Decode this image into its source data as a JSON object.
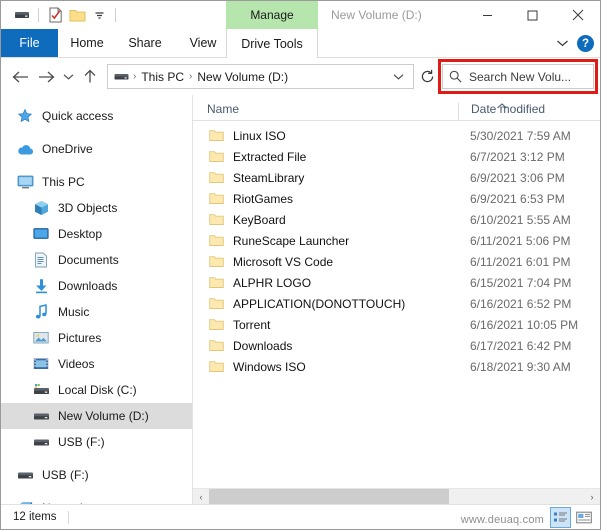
{
  "window": {
    "title": "New Volume (D:)",
    "contextual_header": "Manage",
    "minimize": "—",
    "maximize": "□",
    "close": "✕"
  },
  "quick_access_toolbar": {
    "items": [
      {
        "icon": "drive-icon",
        "name": "drive"
      },
      {
        "icon": "properties-icon",
        "name": "properties"
      },
      {
        "icon": "new-folder-icon",
        "name": "new-folder"
      },
      {
        "icon": "chevron-down-icon",
        "name": "customize"
      }
    ]
  },
  "ribbon": {
    "file_tab": "File",
    "tabs": [
      "Home",
      "Share",
      "View"
    ],
    "contextual_tab": "Drive Tools",
    "collapse_icon": "chevron-down-icon",
    "help_label": "?"
  },
  "address_bar": {
    "back_icon": "arrow-left-icon",
    "forward_icon": "arrow-right-icon",
    "recent_icon": "chevron-down-icon",
    "up_icon": "arrow-up-icon",
    "drive_icon": "drive-icon",
    "breadcrumbs": [
      "This PC",
      "New Volume (D:)"
    ],
    "separator": "›",
    "dropdown_icon": "chevron-down-icon",
    "refresh_icon": "refresh-icon"
  },
  "search": {
    "placeholder": "Search New Volu...",
    "icon": "search-icon",
    "highlight_color": "#e01b15"
  },
  "sidebar": {
    "items": [
      {
        "label": "Quick access",
        "icon": "star-icon",
        "indent": false,
        "selected": false,
        "gap_after": true
      },
      {
        "label": "OneDrive",
        "icon": "cloud-icon",
        "indent": false,
        "selected": false,
        "gap_after": true
      },
      {
        "label": "This PC",
        "icon": "monitor-icon",
        "indent": false,
        "selected": false,
        "gap_after": false
      },
      {
        "label": "3D Objects",
        "icon": "cube-icon",
        "indent": true,
        "selected": false,
        "gap_after": false
      },
      {
        "label": "Desktop",
        "icon": "desktop-icon",
        "indent": true,
        "selected": false,
        "gap_after": false
      },
      {
        "label": "Documents",
        "icon": "documents-icon",
        "indent": true,
        "selected": false,
        "gap_after": false
      },
      {
        "label": "Downloads",
        "icon": "download-icon",
        "indent": true,
        "selected": false,
        "gap_after": false
      },
      {
        "label": "Music",
        "icon": "music-icon",
        "indent": true,
        "selected": false,
        "gap_after": false
      },
      {
        "label": "Pictures",
        "icon": "pictures-icon",
        "indent": true,
        "selected": false,
        "gap_after": false
      },
      {
        "label": "Videos",
        "icon": "videos-icon",
        "indent": true,
        "selected": false,
        "gap_after": false
      },
      {
        "label": "Local Disk (C:)",
        "icon": "local-disk-icon",
        "indent": true,
        "selected": false,
        "gap_after": false
      },
      {
        "label": "New Volume (D:)",
        "icon": "drive-icon",
        "indent": true,
        "selected": true,
        "gap_after": false
      },
      {
        "label": "USB (F:)",
        "icon": "drive-icon",
        "indent": true,
        "selected": false,
        "gap_after": true
      },
      {
        "label": "USB (F:)",
        "icon": "drive-icon",
        "indent": false,
        "selected": false,
        "gap_after": true
      },
      {
        "label": "Network",
        "icon": "network-icon",
        "indent": false,
        "selected": false,
        "gap_after": false
      }
    ]
  },
  "file_list": {
    "columns": [
      {
        "label": "Name",
        "sorted": false
      },
      {
        "label": "Date modified",
        "sorted": true,
        "sort_direction": "ascending"
      }
    ],
    "rows": [
      {
        "name": "Linux ISO",
        "date": "5/30/2021 7:59 AM",
        "icon": "folder-icon"
      },
      {
        "name": "Extracted File",
        "date": "6/7/2021 3:12 PM",
        "icon": "folder-icon"
      },
      {
        "name": "SteamLibrary",
        "date": "6/9/2021 3:06 PM",
        "icon": "folder-icon"
      },
      {
        "name": "RiotGames",
        "date": "6/9/2021 6:53 PM",
        "icon": "folder-icon"
      },
      {
        "name": "KeyBoard",
        "date": "6/10/2021 5:55 AM",
        "icon": "folder-icon"
      },
      {
        "name": "RuneScape Launcher",
        "date": "6/11/2021 5:06 PM",
        "icon": "folder-icon"
      },
      {
        "name": "Microsoft VS Code",
        "date": "6/11/2021 6:01 PM",
        "icon": "folder-icon"
      },
      {
        "name": "ALPHR LOGO",
        "date": "6/15/2021 7:04 PM",
        "icon": "folder-icon"
      },
      {
        "name": "APPLICATION(DONOTTOUCH)",
        "date": "6/16/2021 6:52 PM",
        "icon": "folder-icon"
      },
      {
        "name": "Torrent",
        "date": "6/16/2021 10:05 PM",
        "icon": "folder-icon"
      },
      {
        "name": "Downloads",
        "date": "6/17/2021 6:42 PM",
        "icon": "folder-icon"
      },
      {
        "name": "Windows ISO",
        "date": "6/18/2021 9:30 AM",
        "icon": "folder-icon"
      }
    ]
  },
  "scrollbar": {
    "left_arrow": "‹",
    "right_arrow": "›"
  },
  "status_bar": {
    "item_count": "12 items",
    "details_view_icon": "details-view-icon",
    "large_icons_view_icon": "large-icons-view-icon",
    "watermark": "www.deuaq.com"
  }
}
